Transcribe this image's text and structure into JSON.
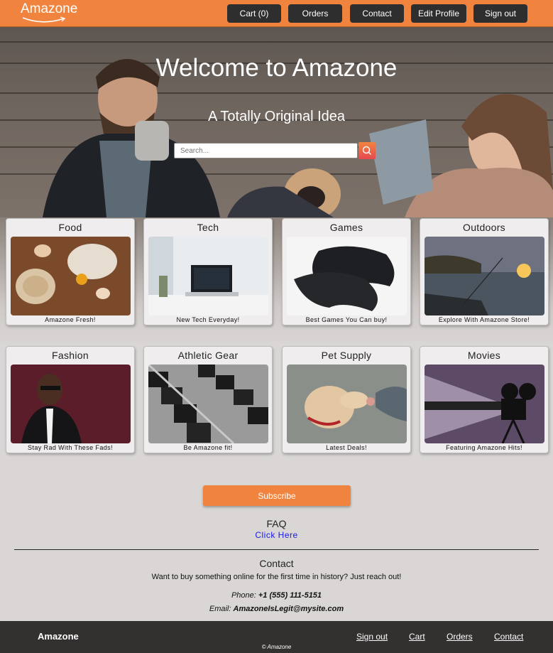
{
  "nav": {
    "logo": "Amazone",
    "buttons": [
      "Cart (0)",
      "Orders",
      "Contact",
      "Edit Profile",
      "Sign out"
    ]
  },
  "hero": {
    "title": "Welcome to Amazone",
    "subtitle": "A Totally Original Idea",
    "search_placeholder": "Search...",
    "search_icon": "search-icon"
  },
  "categories": [
    {
      "title": "Food",
      "caption": "Amazone Fresh!"
    },
    {
      "title": "Tech",
      "caption": "New Tech Everyday!"
    },
    {
      "title": "Games",
      "caption": "Best Games You Can buy!"
    },
    {
      "title": "Outdoors",
      "caption": "Explore With Amazone Store!"
    },
    {
      "title": "Fashion",
      "caption": "Stay Rad With These Fads!"
    },
    {
      "title": "Athletic Gear",
      "caption": "Be Amazone fit!"
    },
    {
      "title": "Pet Supply",
      "caption": "Latest Deals!"
    },
    {
      "title": "Movies",
      "caption": "Featuring Amazone Hits!"
    }
  ],
  "subscribe_label": "Subscribe",
  "faq": {
    "heading": "FAQ",
    "link": "Click Here"
  },
  "contact": {
    "heading": "Contact",
    "text": "Want to buy something online for the first time in history? Just reach out!",
    "phone_label": "Phone: ",
    "phone": "+1 (555) 111-5151",
    "email_label": "Email: ",
    "email": "AmazoneIsLegit@mysite.com"
  },
  "footer": {
    "brand": "Amazone",
    "links": [
      "Sign out",
      "Cart",
      "Orders",
      "Contact"
    ],
    "copyright": "© Amazone"
  },
  "colors": {
    "accent": "#f0843f",
    "dark": "#2e2e2e",
    "link": "#1a1ae6"
  }
}
